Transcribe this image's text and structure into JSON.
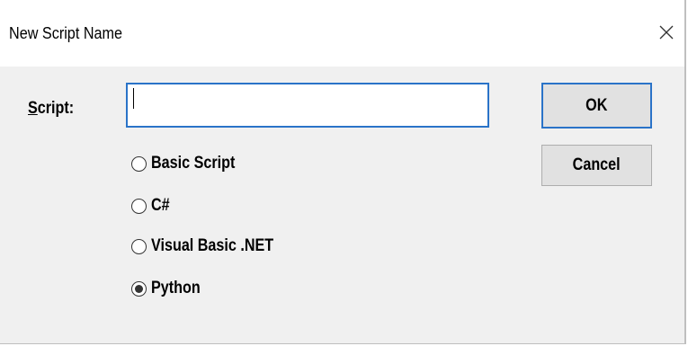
{
  "window": {
    "title": "New Script Name",
    "close_icon": "close-icon"
  },
  "form": {
    "script_label_mnemonic": "S",
    "script_label_rest": "cript:",
    "script_value": "",
    "script_placeholder": ""
  },
  "buttons": {
    "ok_label": "OK",
    "cancel_label": "Cancel"
  },
  "languages": {
    "selected": "Python",
    "options": [
      {
        "label": "Basic Script",
        "checked": false
      },
      {
        "label": "C#",
        "checked": false
      },
      {
        "label": "Visual Basic .NET",
        "checked": false
      },
      {
        "label": "Python",
        "checked": true
      }
    ]
  },
  "colors": {
    "focus_accent": "#2a73c8",
    "dialog_background": "#f0f0f0",
    "button_face": "#e1e1e1"
  }
}
